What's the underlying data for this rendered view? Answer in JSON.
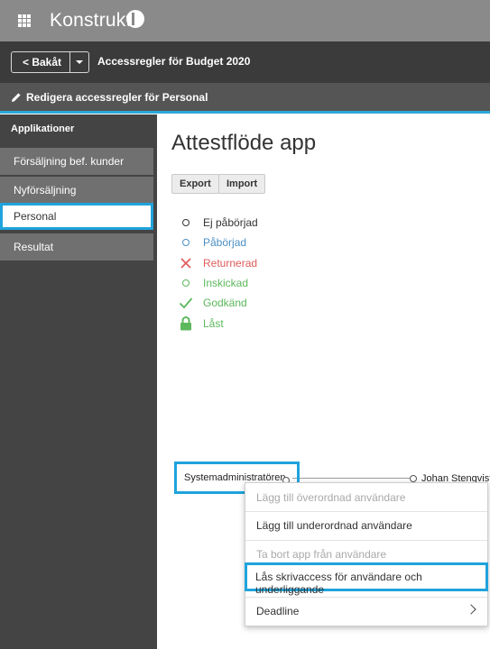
{
  "header": {
    "brand": "Konstrukt"
  },
  "nav": {
    "back_label": "< Bakåt",
    "page_title": "Accessregler för Budget 2020",
    "edit_title": "Redigera accessregler för Personal"
  },
  "sidebar": {
    "header": "Applikationer",
    "items": [
      {
        "label": "Försäljning bef. kunder"
      },
      {
        "label": "Nyförsäljning"
      },
      {
        "label": "Personal",
        "active": true
      },
      {
        "label": "Resultat"
      }
    ]
  },
  "main": {
    "title": "Attestflöde app",
    "export_label": "Export",
    "import_label": "Import",
    "legend": [
      {
        "label": "Ej påbörjad",
        "color": "#333333",
        "icon": "circle-icon"
      },
      {
        "label": "Påbörjad",
        "color": "#4a8fc4",
        "icon": "circle-icon"
      },
      {
        "label": "Returnerad",
        "color": "#e05a5a",
        "icon": "x-icon"
      },
      {
        "label": "Inskickad",
        "color": "#5cb85c",
        "icon": "circle-icon"
      },
      {
        "label": "Godkänd",
        "color": "#5cb85c",
        "icon": "check-icon"
      },
      {
        "label": "Låst",
        "color": "#5cb85c",
        "icon": "lock-icon"
      }
    ]
  },
  "tree": {
    "left_node": "Systemadministratören",
    "right_node": "Johan Stengvist"
  },
  "context_menu": {
    "items": [
      {
        "label": "Lägg till överordnad användare",
        "disabled": true
      },
      {
        "label": "Lägg till underordnad användare",
        "disabled": false
      },
      {
        "label": "Ta bort app från användare",
        "disabled": true
      },
      {
        "label": "Lås skrivaccess för användare och underliggande",
        "disabled": false
      },
      {
        "label": "Deadline",
        "disabled": false
      }
    ]
  },
  "colors": {
    "accent": "#1fa3dc"
  }
}
